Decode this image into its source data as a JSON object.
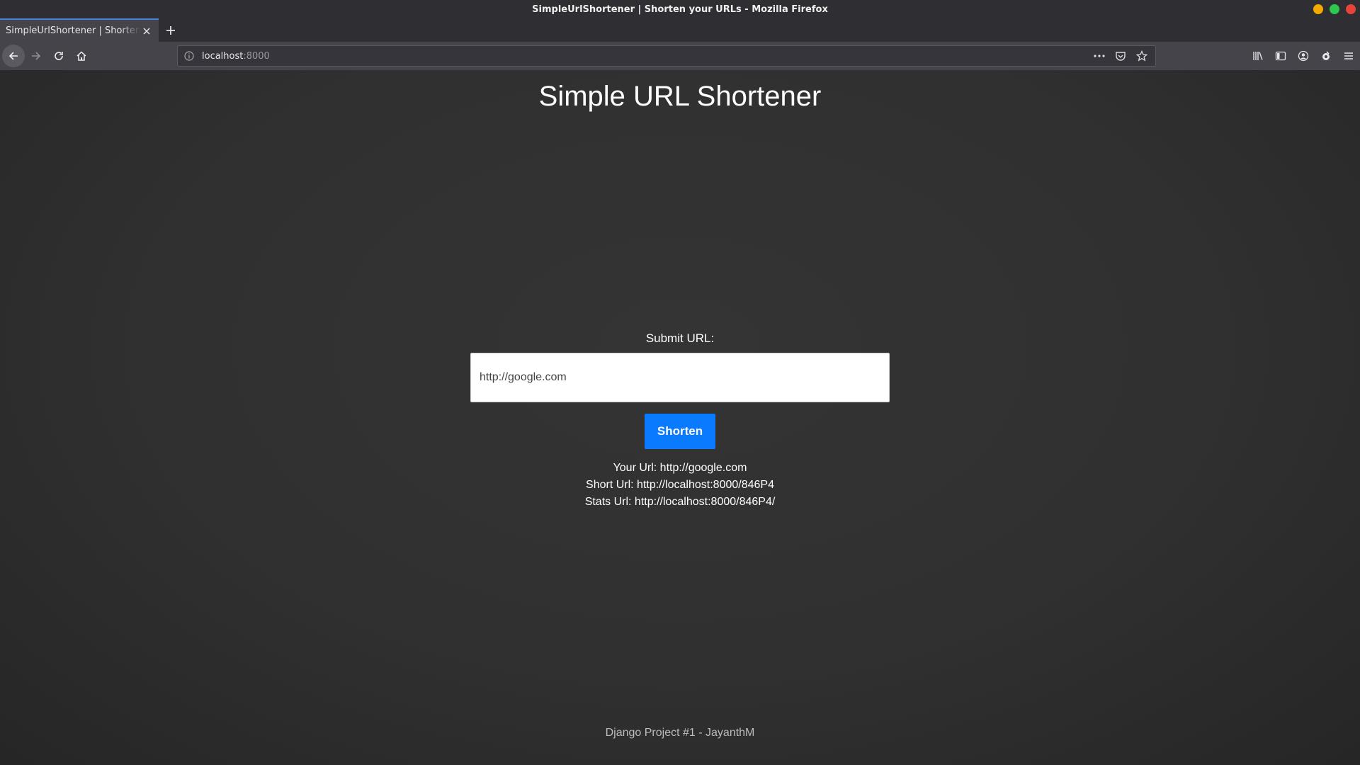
{
  "window": {
    "title": "SimpleUrlShortener | Shorten your URLs - Mozilla Firefox",
    "controls": [
      "minimize",
      "maximize",
      "close"
    ]
  },
  "tabs": [
    {
      "label": "SimpleUrlShortener | Shorten your URLs",
      "active": true
    }
  ],
  "navbar": {
    "url_host": "localhost",
    "url_port": ":8000"
  },
  "page": {
    "title": "Simple URL Shortener",
    "submit_label": "Submit URL:",
    "input_value": "http://google.com",
    "shorten_label": "Shorten",
    "results": {
      "your_url": "Your Url: http://google.com",
      "short_url": "Short Url: http://localhost:8000/846P4",
      "stats_url": "Stats Url: http://localhost:8000/846P4/"
    },
    "footer": "Django Project #1 - JayanthM"
  },
  "colors": {
    "accent": "#0a7bff",
    "tab_highlight": "#4a7fe0",
    "page_background": "#303030"
  }
}
